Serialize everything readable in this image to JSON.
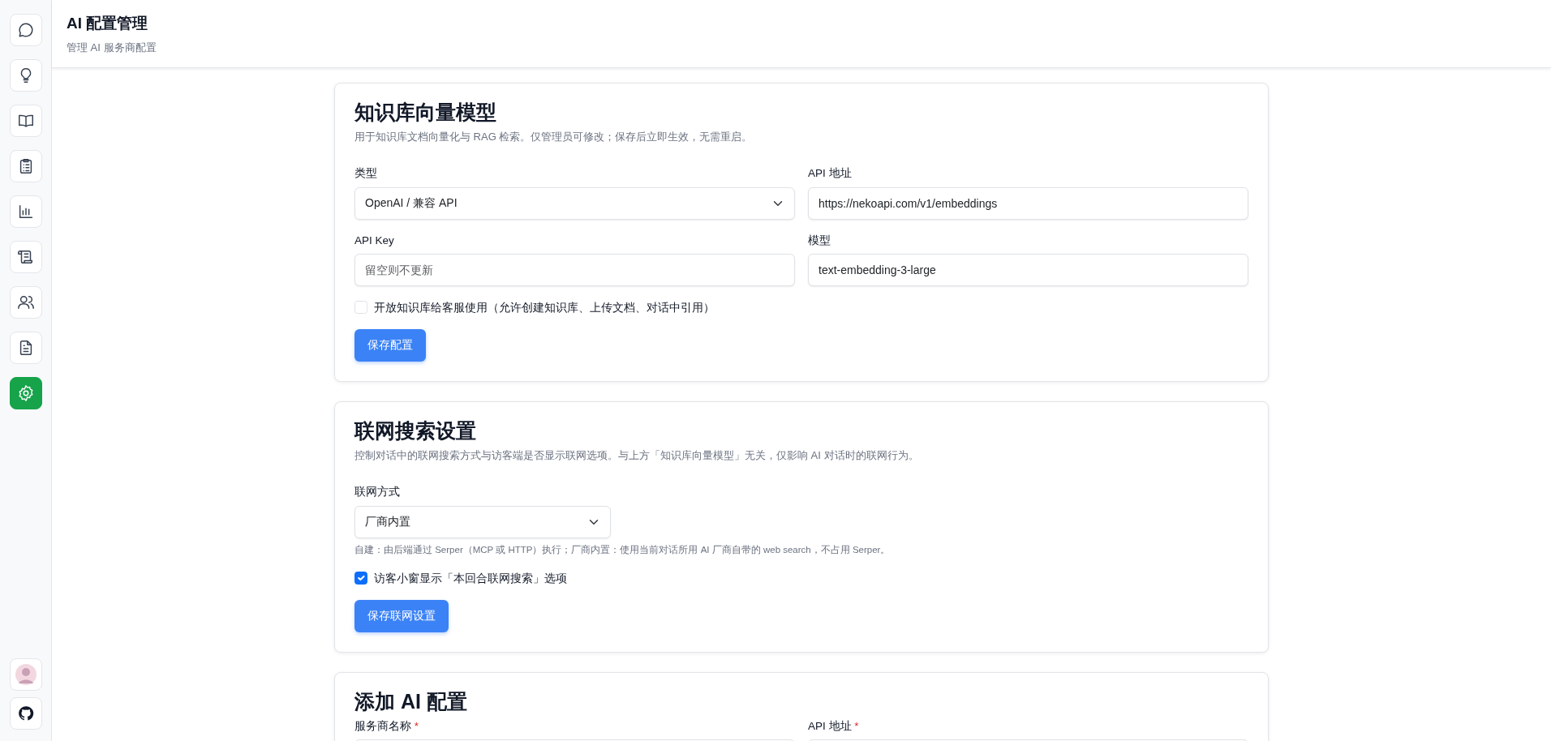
{
  "sidebar": {
    "items": [
      {
        "selected": false
      },
      {
        "selected": false
      },
      {
        "selected": false
      },
      {
        "selected": false
      },
      {
        "selected": false
      },
      {
        "selected": false
      },
      {
        "selected": false
      },
      {
        "selected": false
      },
      {
        "selected": true
      }
    ]
  },
  "header": {
    "title": "AI 配置管理",
    "subtitle": "管理 AI 服务商配置"
  },
  "sections": [
    {
      "title": "知识库向量模型",
      "description": "用于知识库文档向量化与 RAG 检索。仅管理员可修改；保存后立即生效，无需重启。",
      "fields": [
        {
          "kind": "select",
          "label": "类型",
          "value": "OpenAI / 兼容 API"
        },
        {
          "kind": "input",
          "label": "API 地址",
          "value": "https://nekoapi.com/v1/embeddings"
        },
        {
          "kind": "input",
          "label": "API Key",
          "placeholder": "留空则不更新"
        },
        {
          "kind": "input",
          "label": "模型",
          "value": "text-embedding-3-large"
        }
      ],
      "checkbox": {
        "label": "开放知识库给客服使用（允许创建知识库、上传文档、对话中引用）",
        "checked": false
      },
      "button": "保存配置"
    },
    {
      "title": "联网搜索设置",
      "description": "控制对话中的联网搜索方式与访客端是否显示联网选项。与上方「知识库向量模型」无关，仅影响 AI 对话时的联网行为。",
      "fields": [
        {
          "kind": "select",
          "label": "联网方式",
          "value": "厂商内置",
          "narrow": true,
          "help": "自建：由后端通过 Serper（MCP 或 HTTP）执行；厂商内置：使用当前对话所用 AI 厂商自带的 web search，不占用 Serper。"
        }
      ],
      "checkbox": {
        "label": "访客小窗显示「本回合联网搜索」选项",
        "checked": true
      },
      "button": "保存联网设置"
    },
    {
      "title": "添加 AI 配置",
      "fields": [
        {
          "kind": "input",
          "label": "服务商名称",
          "marker": "*"
        },
        {
          "kind": "input",
          "label": "API 地址",
          "marker": "*"
        }
      ]
    }
  ]
}
